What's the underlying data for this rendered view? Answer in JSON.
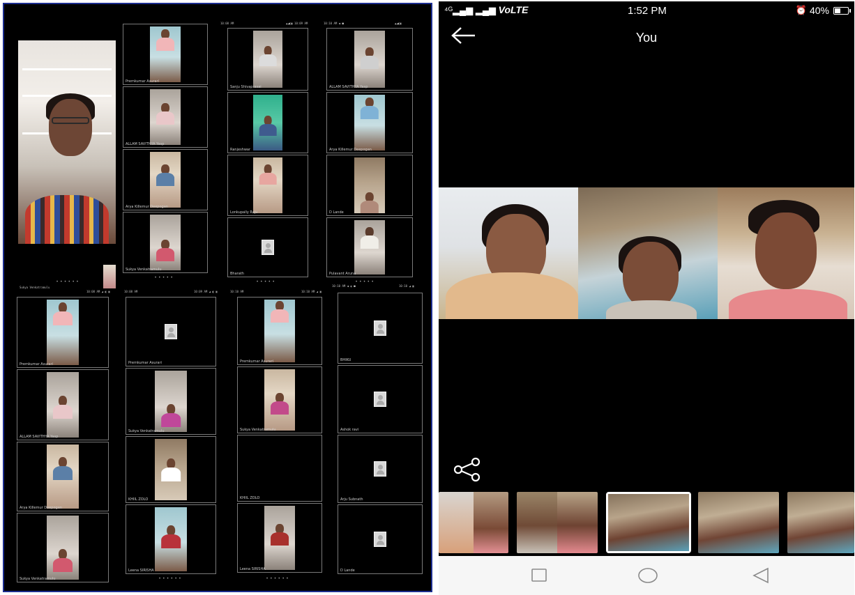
{
  "phone": {
    "status_bar": {
      "carrier": "VoLTE",
      "time": "1:52 PM",
      "battery": "40%",
      "battery_level": 0.4,
      "icons": [
        "signal-icon",
        "alarm-icon",
        "battery-icon"
      ]
    },
    "title": "You",
    "back_icon": "arrow-left-icon",
    "share_icon": "share-icon",
    "thumbnails_count_visible": 5,
    "selected_thumbnail": 3,
    "navbar": [
      "recents-square-icon",
      "home-circle-icon",
      "back-triangle-icon"
    ]
  },
  "collage": {
    "status_lines": [
      "10:08 AM",
      "10:09 AM",
      "10:10 AM",
      "10:09 AM",
      "10:08 AM",
      "10:10 AM"
    ],
    "tiles": [
      {
        "name": "Premkumar Asurari"
      },
      {
        "name": "ALLAM SAVITHYA Yasp"
      },
      {
        "name": "Arya Killemur Deepogan"
      },
      {
        "name": "Sukya Venkatramulu"
      },
      {
        "name": "Sanju Shivaprasai"
      },
      {
        "name": "Ranjeshwar"
      },
      {
        "name": "Lonkupally Raju"
      },
      {
        "name": "Bharath"
      },
      {
        "name": "ALLAM SAVITHYA Yasp"
      },
      {
        "name": "Arya Killemur Deepogan"
      },
      {
        "name": "D Lande"
      },
      {
        "name": "Pulavant Aruna"
      },
      {
        "name": "Sukya Venkatramulu"
      },
      {
        "name": "Premkumar Asurari"
      },
      {
        "name": "ALLAM SAVITHYA Yasp"
      },
      {
        "name": "Arya Killemur Deepogan"
      },
      {
        "name": "Sukya Venkatramulu"
      },
      {
        "name": "Premkumar Asurari"
      },
      {
        "name": "Sukya Venkatramulu"
      },
      {
        "name": "KHIIL ZOLO"
      },
      {
        "name": "Leena SIRISHA"
      },
      {
        "name": "Premkumar Asurari"
      },
      {
        "name": "Sukya Venkatramulu"
      },
      {
        "name": "KHIIL ZOLO"
      },
      {
        "name": "Leena SIRISHA"
      },
      {
        "name": "BHIKU"
      },
      {
        "name": "Ashok ravi"
      },
      {
        "name": "Arju Subnath"
      },
      {
        "name": "D Lande"
      }
    ]
  }
}
